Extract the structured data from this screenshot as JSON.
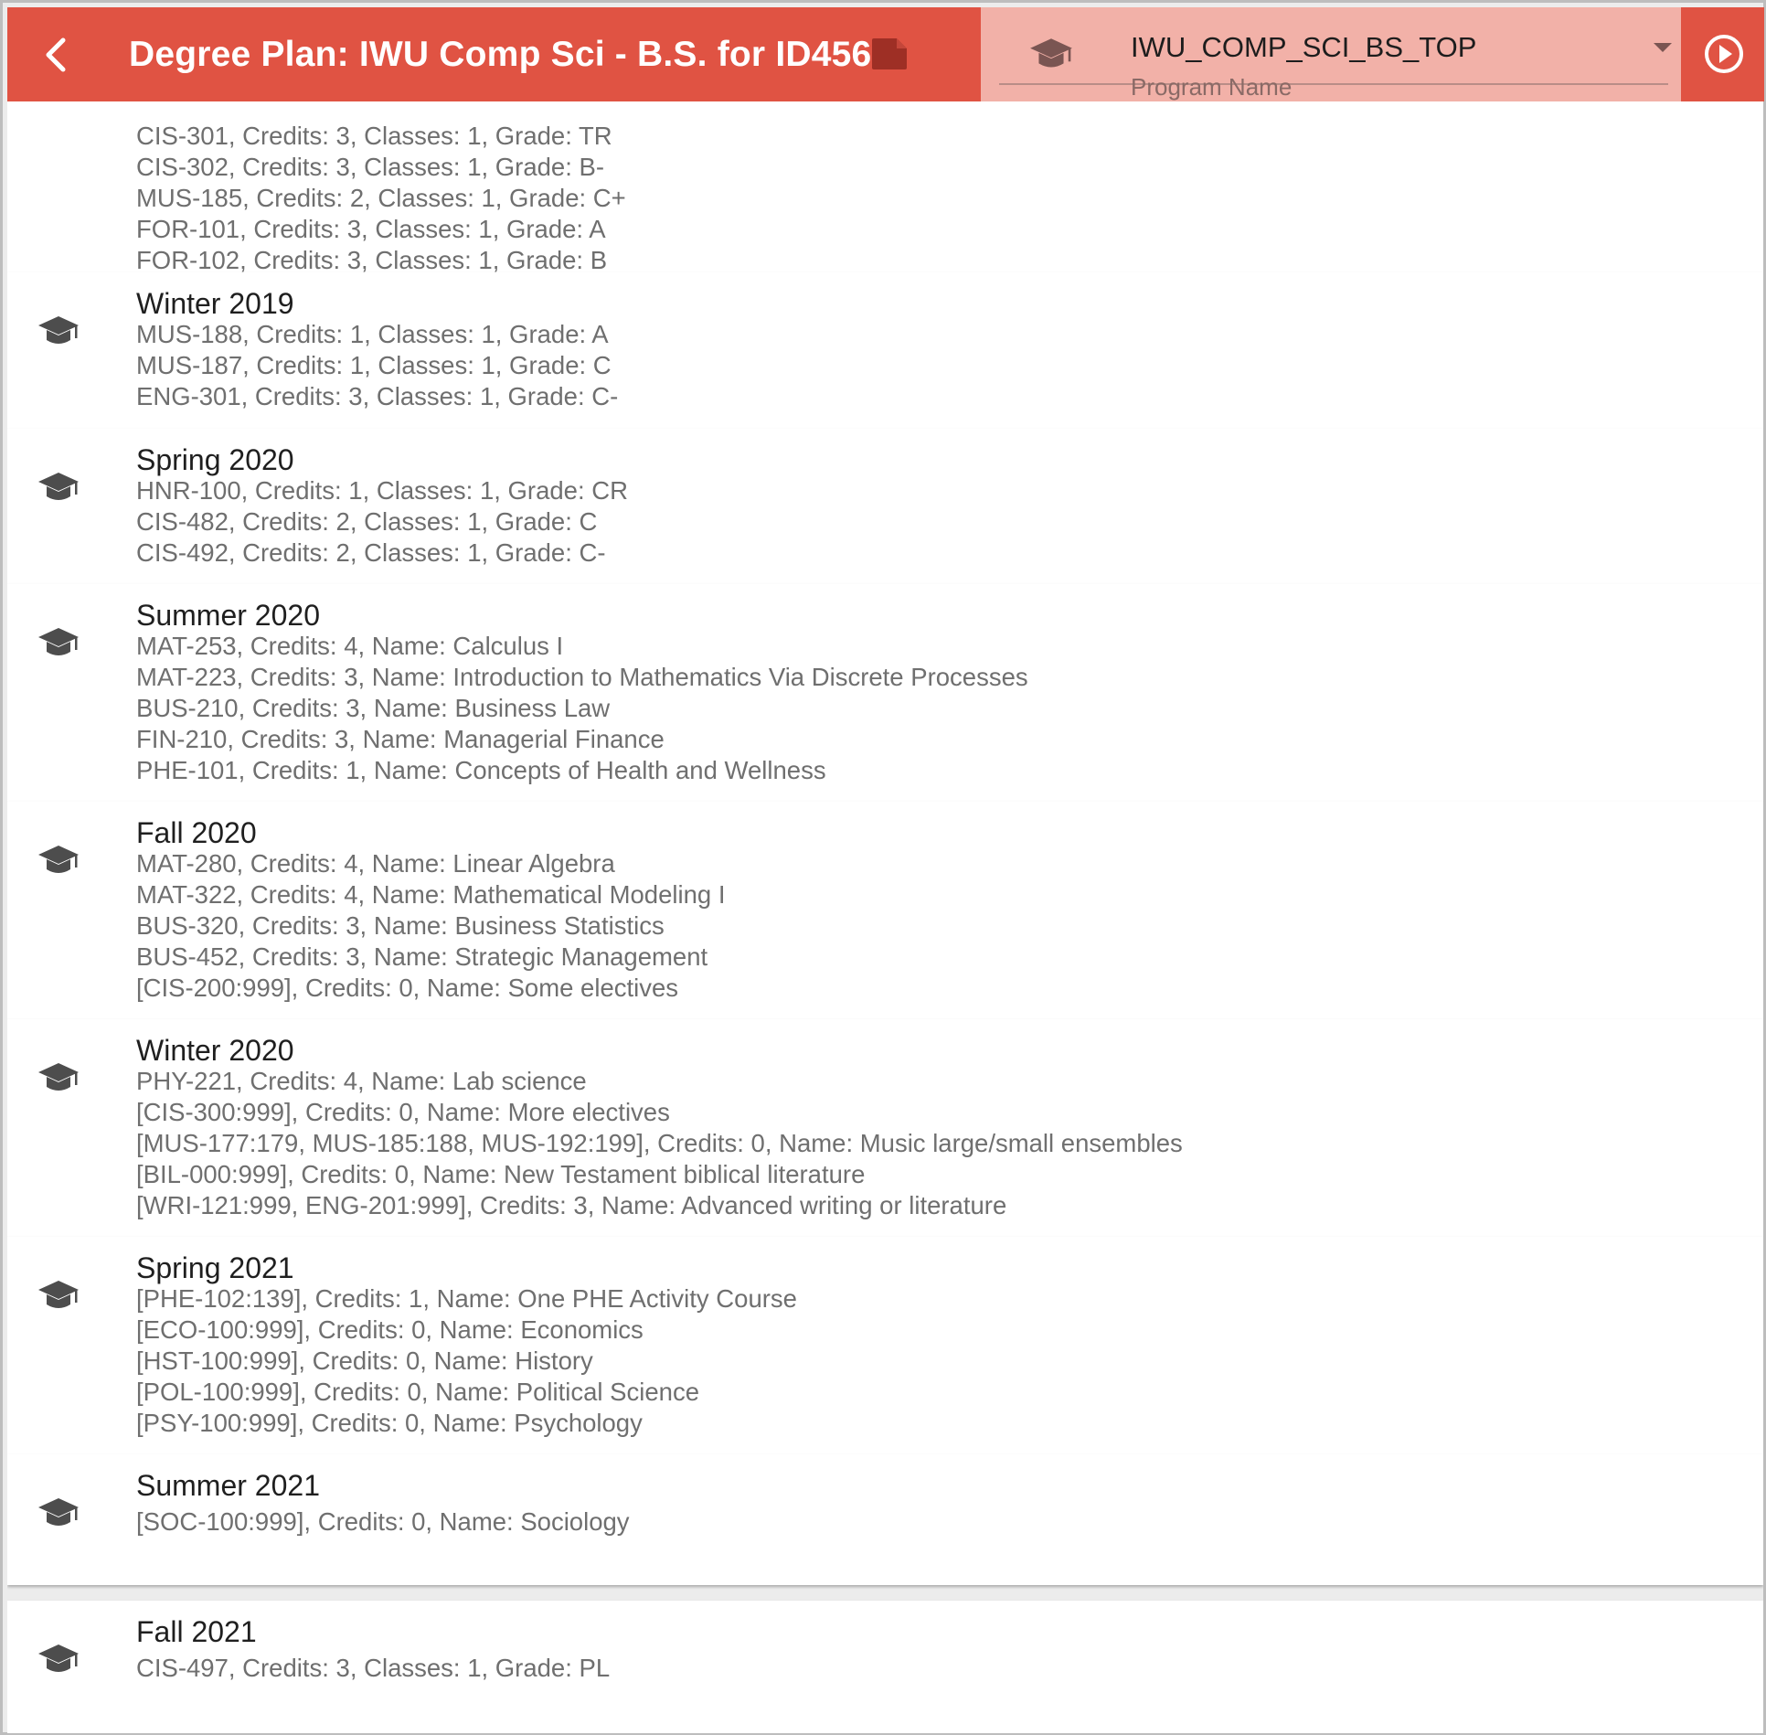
{
  "header": {
    "title": "Degree Plan: IWU Comp Sci - B.S. for ID456",
    "program_value": "IWU_COMP_SCI_BS_TOP",
    "program_label": "Program Name",
    "icons": [
      "back-arrow-icon",
      "save-file-icon",
      "graduation-cap-icon",
      "dropdown-arrow-icon",
      "play-circle-icon"
    ]
  },
  "colors": {
    "toolbar": "#e05343",
    "program_field": "#f2b1a8"
  },
  "terms": [
    {
      "name": "",
      "courses": [
        "CIS-301, Credits: 3, Classes: 1, Grade: TR",
        "CIS-302, Credits: 3, Classes: 1, Grade: B-",
        "MUS-185, Credits: 2, Classes: 1, Grade: C+",
        "FOR-101, Credits: 3, Classes: 1, Grade: A",
        "FOR-102, Credits: 3, Classes: 1, Grade: B"
      ]
    },
    {
      "name": "Winter 2019",
      "courses": [
        "MUS-188, Credits: 1, Classes: 1, Grade: A",
        "MUS-187, Credits: 1, Classes: 1, Grade: C",
        "ENG-301, Credits: 3, Classes: 1, Grade: C-"
      ]
    },
    {
      "name": "Spring 2020",
      "courses": [
        "HNR-100, Credits: 1, Classes: 1, Grade: CR",
        "CIS-482, Credits: 2, Classes: 1, Grade: C",
        "CIS-492, Credits: 2, Classes: 1, Grade: C-"
      ]
    },
    {
      "name": "Summer 2020",
      "courses": [
        "MAT-253, Credits: 4, Name: Calculus I",
        "MAT-223, Credits: 3, Name: Introduction to Mathematics Via Discrete Processes",
        "BUS-210, Credits: 3, Name: Business Law",
        "FIN-210, Credits: 3, Name: Managerial Finance",
        "PHE-101, Credits: 1, Name: Concepts of Health and Wellness"
      ]
    },
    {
      "name": "Fall 2020",
      "courses": [
        "MAT-280, Credits: 4, Name: Linear Algebra",
        "MAT-322, Credits: 4, Name: Mathematical Modeling I",
        "BUS-320, Credits: 3, Name: Business Statistics",
        "BUS-452, Credits: 3, Name: Strategic Management",
        "[CIS-200:999], Credits: 0, Name: Some electives"
      ]
    },
    {
      "name": "Winter 2020",
      "courses": [
        "PHY-221, Credits: 4, Name: Lab science",
        "[CIS-300:999], Credits: 0, Name: More electives",
        "[MUS-177:179, MUS-185:188, MUS-192:199], Credits: 0, Name: Music large/small ensembles",
        "[BIL-000:999], Credits: 0, Name: New Testament biblical literature",
        "[WRI-121:999, ENG-201:999], Credits: 3, Name: Advanced writing or literature"
      ]
    },
    {
      "name": "Spring 2021",
      "courses": [
        "[PHE-102:139], Credits: 1, Name: One PHE Activity Course",
        "[ECO-100:999], Credits: 0, Name: Economics",
        "[HST-100:999], Credits: 0, Name: History",
        "[POL-100:999], Credits: 0, Name: Political Science",
        "[PSY-100:999], Credits: 0, Name: Psychology"
      ]
    },
    {
      "name": "Summer 2021",
      "courses": [
        "[SOC-100:999], Credits: 0, Name: Sociology"
      ]
    },
    {
      "name": "Fall 2021",
      "courses": [
        "CIS-497, Credits: 3, Classes: 1, Grade: PL"
      ]
    }
  ]
}
